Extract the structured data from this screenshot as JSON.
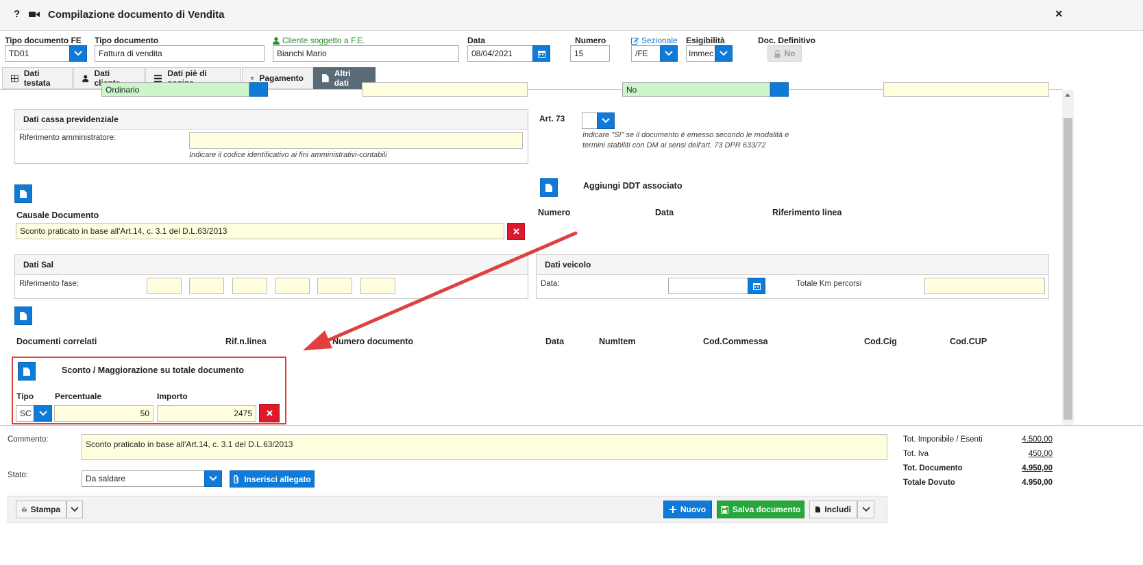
{
  "window": {
    "title": "Compilazione documento di Vendita",
    "help_label": "?",
    "close_label": "×"
  },
  "header": {
    "tipo_fe_label": "Tipo documento FE",
    "tipo_fe_value": "TD01",
    "tipo_doc_label": "Tipo documento",
    "tipo_doc_value": "Fattura di vendita",
    "cliente_label": "Cliente soggetto a F.E.",
    "cliente_value": "Bianchi Mario",
    "data_label": "Data",
    "data_value": "08/04/2021",
    "numero_label": "Numero",
    "numero_value": "15",
    "sezionale_label": "Sezionale",
    "sezionale_value": "/FE",
    "esigibilita_label": "Esigibilità",
    "esigibilita_value": "Immec",
    "doc_definitivo_label": "Doc. Definitivo",
    "doc_definitivo_value": "No"
  },
  "tabs": [
    {
      "label": "Dati testata"
    },
    {
      "label": "Dati cliente"
    },
    {
      "label": "Dati piè di pagina"
    },
    {
      "label": "Pagamento"
    },
    {
      "label": "Altri dati"
    }
  ],
  "top_cut": {
    "field1_value": "Ordinario",
    "field3_value": "No"
  },
  "cassa": {
    "title": "Dati cassa previdenziale",
    "rif_label": "Riferimento amministratore:",
    "rif_value": "",
    "rif_hint": "Indicare il codice identificativo ai fini amministrativi-contabili"
  },
  "art73": {
    "label": "Art. 73",
    "hint_line1": "Indicare \"SI\" se il documento è emesso secondo le modalità e",
    "hint_line2": "termini stabiliti con DM ai sensi dell'art. 73 DPR 633/72"
  },
  "ddt": {
    "title": "Aggiungi DDT associato",
    "col_numero": "Numero",
    "col_data": "Data",
    "col_rif": "Riferimento linea"
  },
  "causale": {
    "label": "Causale Documento",
    "value": "Sconto praticato in base all'Art.14, c. 3.1 del D.L.63/2013"
  },
  "sal": {
    "title": "Dati Sal",
    "rif_label": "Riferimento fase:"
  },
  "veicolo": {
    "title": "Dati veicolo",
    "data_label": "Data:",
    "km_label": "Totale Km percorsi"
  },
  "correlati": {
    "col_doc": "Documenti correlati",
    "col_rif": "Rif.n.linea",
    "col_num": "Numero documento",
    "col_data": "Data",
    "col_numitem": "NumItem",
    "col_commessa": "Cod.Commessa",
    "col_cig": "Cod.Cig",
    "col_cup": "Cod.CUP"
  },
  "sconto": {
    "title": "Sconto / Maggiorazione su totale documento",
    "tipo_label": "Tipo",
    "tipo_value": "SC",
    "perc_label": "Percentuale",
    "perc_value": "50",
    "importo_label": "Importo",
    "importo_value": "2475"
  },
  "footer": {
    "commento_label": "Commento:",
    "commento_value": "Sconto praticato in base all'Art.14, c. 3.1 del D.L.63/2013",
    "stato_label": "Stato:",
    "stato_value": "Da saldare",
    "allegato_label": "Inserisci allegato",
    "stampa_label": "Stampa",
    "nuovo_label": "Nuovo",
    "salva_label": "Salva documento",
    "includi_label": "Includi"
  },
  "totals": {
    "imponibile_label": "Tot. Imponibile / Esenti",
    "imponibile_value": "4.500,00",
    "iva_label": "Tot. Iva",
    "iva_value": "450,00",
    "documento_label": "Tot. Documento",
    "documento_value": "4.950,00",
    "dovuto_label": "Totale Dovuto",
    "dovuto_value": "4.950,00"
  },
  "colors": {
    "accent": "#0f7ad8",
    "danger": "#dc1a2c",
    "success": "#27a83a",
    "tab_active": "#5a6b78",
    "highlight": "#e04040",
    "field_yellow": "#ffffe0",
    "field_green": "#ccf5cc"
  }
}
